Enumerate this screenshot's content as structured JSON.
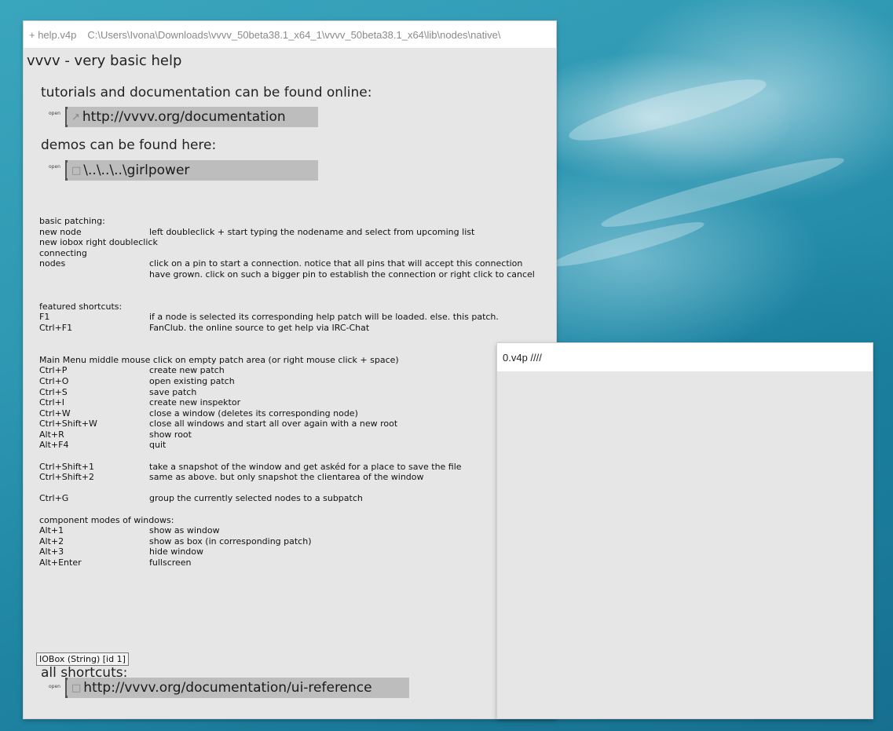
{
  "help_window": {
    "title_name": "+ help.v4p",
    "title_path": "C:\\Users\\Ivona\\Downloads\\vvvv_50beta38.1_x64_1\\vvvv_50beta38.1_x64\\lib\\nodes\\native\\",
    "heading": "vvvv - very basic help",
    "tutorials_heading": "tutorials and documentation can be found online:",
    "open_label": "open",
    "doc_link": "http://vvvv.org/documentation",
    "demos_heading": "demos can be found here:",
    "demos_path": "\\..\\..\\..\\girlpower",
    "basic_patching": {
      "title": "basic patching:",
      "rows": [
        {
          "k": "new node",
          "v": "left doubleclick + start typing the nodename and select from upcoming list"
        },
        {
          "k": "new iobox   right doubleclick",
          "v": ""
        },
        {
          "k": "connecting",
          "v": ""
        },
        {
          "k": "nodes",
          "v": "click on a pin to start a connection. notice that all pins that will accept this connection"
        },
        {
          "k": "",
          "v": "have grown. click on such a bigger pin to establish the connection or right click to cancel"
        }
      ]
    },
    "featured": {
      "title": "featured shortcuts:",
      "rows": [
        {
          "k": "F1",
          "v": "if a node is selected its corresponding help patch will be loaded. else. this patch."
        },
        {
          "k": "Ctrl+F1",
          "v": "FanClub. the online source to get help via IRC-Chat"
        }
      ]
    },
    "main_menu": {
      "title": "Main Menu   middle mouse click on empty patch area (or right mouse click + space)",
      "rows": [
        {
          "k": "Ctrl+P",
          "v": "create new patch"
        },
        {
          "k": "Ctrl+O",
          "v": "open existing patch"
        },
        {
          "k": "Ctrl+S",
          "v": "save patch"
        },
        {
          "k": "Ctrl+I",
          "v": "create new inspektor"
        },
        {
          "k": "Ctrl+W",
          "v": "close a window (deletes its corresponding node)"
        },
        {
          "k": "Ctrl+Shift+W",
          "v": "close all windows and start all over again with a new root"
        },
        {
          "k": "Alt+R",
          "v": "show root"
        },
        {
          "k": "Alt+F4",
          "v": "quit"
        }
      ]
    },
    "snapshot": {
      "rows": [
        {
          "k": "Ctrl+Shift+1",
          "v": "take a snapshot of the window and get askéd for a place to save the file"
        },
        {
          "k": "Ctrl+Shift+2",
          "v": "same as above. but only snapshot the clientarea of the window"
        }
      ]
    },
    "group": {
      "rows": [
        {
          "k": "Ctrl+G",
          "v": "group the currently selected nodes to a subpatch"
        }
      ]
    },
    "component_modes": {
      "title": "component modes of windows:",
      "rows": [
        {
          "k": "Alt+1",
          "v": "show as window"
        },
        {
          "k": "Alt+2",
          "v": "show as box (in corresponding patch)"
        },
        {
          "k": "Alt+3",
          "v": "hide window"
        },
        {
          "k": "Alt+Enter",
          "v": "fullscreen"
        }
      ]
    },
    "tooltip": "IOBox (String) [id 1]",
    "shortcuts_heading": "all shortcuts:",
    "ui_ref_link": "http://vvvv.org/documentation/ui-reference"
  },
  "second_window": {
    "title": "0.v4p ////"
  },
  "icons": {
    "link_glyph": "↗",
    "file_glyph": "□"
  }
}
